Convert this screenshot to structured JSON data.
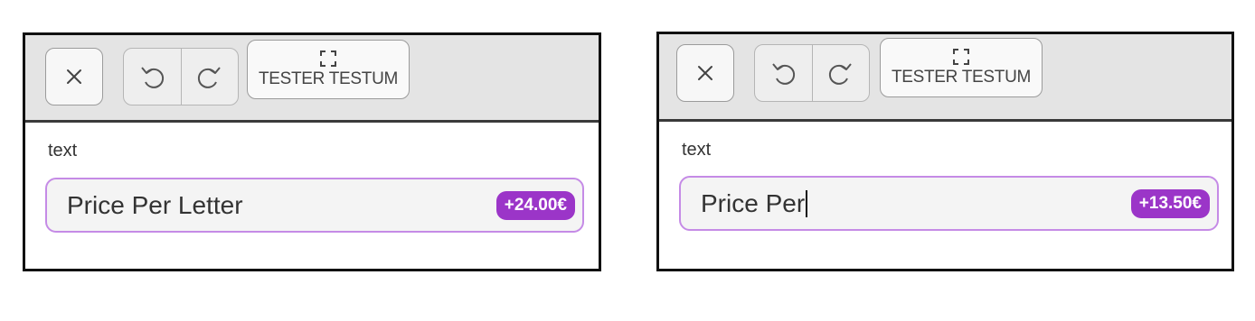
{
  "panels": [
    {
      "toolbar": {
        "close_icon": "close-icon",
        "undo_icon": "undo-icon",
        "redo_icon": "redo-icon",
        "fullscreen_icon": "fullscreen-icon",
        "tester_label": "TESTER TESTUM"
      },
      "field": {
        "label": "text",
        "value": "Price Per Letter",
        "price": "+24.00€",
        "has_caret": false
      }
    },
    {
      "toolbar": {
        "close_icon": "close-icon",
        "undo_icon": "undo-icon",
        "redo_icon": "redo-icon",
        "fullscreen_icon": "fullscreen-icon",
        "tester_label": "TESTER TESTUM"
      },
      "field": {
        "label": "text",
        "value": "Price Per",
        "price": "+13.50€",
        "has_caret": true
      }
    }
  ],
  "colors": {
    "accent_purple": "#9b35c8",
    "input_border": "#c58be6",
    "toolbar_bg": "#e4e4e4"
  }
}
